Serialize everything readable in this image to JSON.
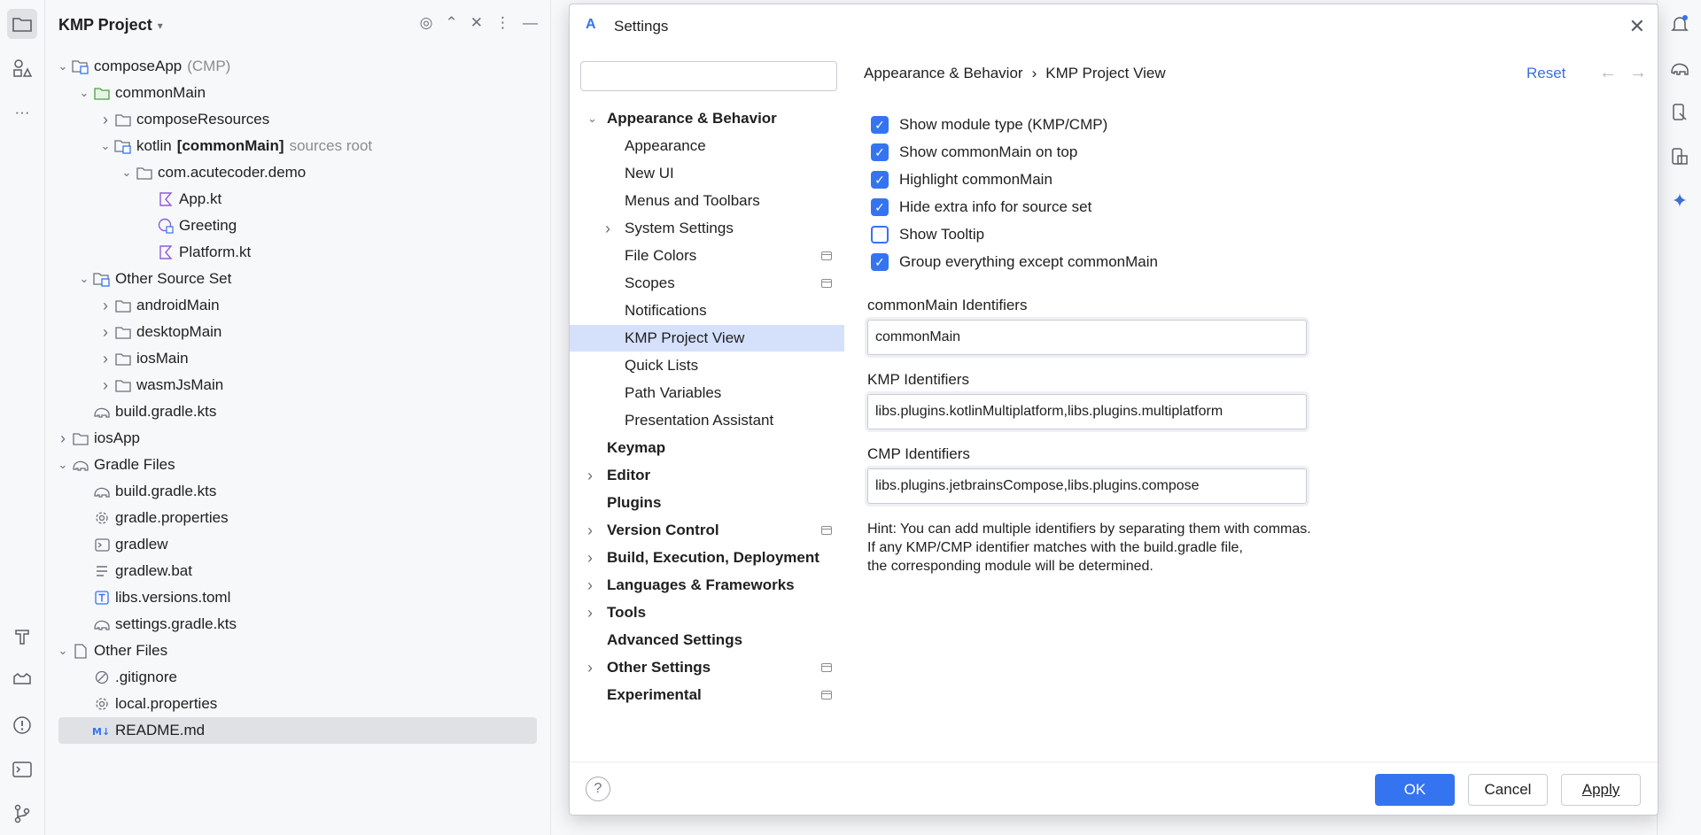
{
  "project": {
    "title": "KMP Project",
    "tree": [
      {
        "label": "composeApp",
        "suffix": "(CMP)",
        "depth": 0,
        "chev": "down",
        "icon": "module-icon"
      },
      {
        "label": "commonMain",
        "depth": 1,
        "chev": "down",
        "icon": "folder-green-icon"
      },
      {
        "label": "composeResources",
        "depth": 2,
        "chev": "right",
        "icon": "folder-icon"
      },
      {
        "label": "kotlin",
        "bold": "[commonMain]",
        "suffix": "sources root",
        "depth": 2,
        "chev": "down",
        "icon": "source-folder-icon"
      },
      {
        "label": "com.acutecoder.demo",
        "depth": 3,
        "chev": "down",
        "icon": "package-icon"
      },
      {
        "label": "App.kt",
        "depth": 4,
        "icon": "kotlin-file-icon"
      },
      {
        "label": "Greeting",
        "depth": 4,
        "icon": "kotlin-class-icon"
      },
      {
        "label": "Platform.kt",
        "depth": 4,
        "icon": "kotlin-file-icon"
      },
      {
        "label": "Other Source Set",
        "depth": 1,
        "chev": "down",
        "icon": "module-folder-icon"
      },
      {
        "label": "androidMain",
        "depth": 2,
        "chev": "right",
        "icon": "folder-icon"
      },
      {
        "label": "desktopMain",
        "depth": 2,
        "chev": "right",
        "icon": "folder-icon"
      },
      {
        "label": "iosMain",
        "depth": 2,
        "chev": "right",
        "icon": "folder-icon"
      },
      {
        "label": "wasmJsMain",
        "depth": 2,
        "chev": "right",
        "icon": "folder-icon"
      },
      {
        "label": "build.gradle.kts",
        "depth": 1,
        "icon": "gradle-icon"
      },
      {
        "label": "iosApp",
        "depth": 0,
        "chev": "right",
        "icon": "folder-icon"
      },
      {
        "label": "Gradle Files",
        "depth": 0,
        "chev": "down",
        "icon": "gradle-icon"
      },
      {
        "label": "build.gradle.kts",
        "depth": 1,
        "icon": "gradle-icon"
      },
      {
        "label": "gradle.properties",
        "depth": 1,
        "icon": "gear-icon"
      },
      {
        "label": "gradlew",
        "depth": 1,
        "icon": "terminal-icon"
      },
      {
        "label": "gradlew.bat",
        "depth": 1,
        "icon": "text-lines-icon"
      },
      {
        "label": "libs.versions.toml",
        "depth": 1,
        "icon": "toml-icon"
      },
      {
        "label": "settings.gradle.kts",
        "depth": 1,
        "icon": "gradle-icon"
      },
      {
        "label": "Other Files",
        "depth": 0,
        "chev": "down",
        "icon": "file-icon"
      },
      {
        "label": ".gitignore",
        "depth": 1,
        "icon": "ignore-icon"
      },
      {
        "label": "local.properties",
        "depth": 1,
        "icon": "gear-icon"
      },
      {
        "label": "README.md",
        "depth": 1,
        "icon": "markdown-icon",
        "selected": true
      }
    ]
  },
  "dialog": {
    "title": "Settings",
    "search_placeholder": "",
    "nav": [
      {
        "label": "Appearance & Behavior",
        "level": 0,
        "chev": "down",
        "bold": true
      },
      {
        "label": "Appearance",
        "level": 1
      },
      {
        "label": "New UI",
        "level": 1
      },
      {
        "label": "Menus and Toolbars",
        "level": 1
      },
      {
        "label": "System Settings",
        "level": 1,
        "chev": "right"
      },
      {
        "label": "File Colors",
        "level": 1,
        "badge": true
      },
      {
        "label": "Scopes",
        "level": 1,
        "badge": true
      },
      {
        "label": "Notifications",
        "level": 1
      },
      {
        "label": "KMP Project View",
        "level": 1,
        "selected": true
      },
      {
        "label": "Quick Lists",
        "level": 1
      },
      {
        "label": "Path Variables",
        "level": 1
      },
      {
        "label": "Presentation Assistant",
        "level": 1
      },
      {
        "label": "Keymap",
        "level": 0,
        "bold": true
      },
      {
        "label": "Editor",
        "level": 0,
        "chev": "right",
        "bold": true
      },
      {
        "label": "Plugins",
        "level": 0,
        "bold": true
      },
      {
        "label": "Version Control",
        "level": 0,
        "chev": "right",
        "bold": true,
        "badge": true
      },
      {
        "label": "Build, Execution, Deployment",
        "level": 0,
        "chev": "right",
        "bold": true
      },
      {
        "label": "Languages & Frameworks",
        "level": 0,
        "chev": "right",
        "bold": true
      },
      {
        "label": "Tools",
        "level": 0,
        "chev": "right",
        "bold": true
      },
      {
        "label": "Advanced Settings",
        "level": 0,
        "bold": true
      },
      {
        "label": "Other Settings",
        "level": 0,
        "chev": "right",
        "bold": true,
        "badge": true
      },
      {
        "label": "Experimental",
        "level": 0,
        "bold": true,
        "badge": true
      }
    ],
    "breadcrumb": {
      "parent": "Appearance & Behavior",
      "separator": "›",
      "current": "KMP Project View"
    },
    "reset_label": "Reset",
    "checkboxes": [
      {
        "label": "Show module type (KMP/CMP)",
        "checked": true
      },
      {
        "label": "Show commonMain on top",
        "checked": true
      },
      {
        "label": "Highlight commonMain",
        "checked": true
      },
      {
        "label": "Hide extra info for source set",
        "checked": true
      },
      {
        "label": "Show Tooltip",
        "checked": false
      },
      {
        "label": "Group everything except commonMain",
        "checked": true
      }
    ],
    "fields": {
      "common_label": "commonMain Identifiers",
      "common_value": "commonMain",
      "kmp_label": "KMP Identifiers",
      "kmp_value": "libs.plugins.kotlinMultiplatform,libs.plugins.multiplatform",
      "cmp_label": "CMP Identifiers",
      "cmp_value": "libs.plugins.jetbrainsCompose,libs.plugins.compose"
    },
    "hint": [
      "Hint: You can add multiple identifiers by separating them with commas.",
      "If any KMP/CMP identifier matches with the build.gradle file,",
      "the corresponding module will be determined."
    ],
    "buttons": {
      "ok": "OK",
      "cancel": "Cancel",
      "apply": "Apply"
    },
    "help_label": "?"
  },
  "colors": {
    "accent": "#3574f0",
    "selection": "#d5e1fb",
    "link": "#3b6fd6"
  }
}
